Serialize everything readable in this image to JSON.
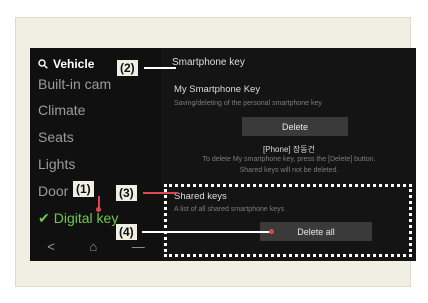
{
  "sidebar": {
    "header": "Vehicle",
    "items": [
      {
        "label": "Built-in cam"
      },
      {
        "label": "Climate"
      },
      {
        "label": "Seats"
      },
      {
        "label": "Lights"
      },
      {
        "label": "Door"
      },
      {
        "label": "Digital key",
        "active": true
      }
    ],
    "nav": [
      "<",
      "⌂",
      "—"
    ]
  },
  "content": {
    "title": "Smartphone key",
    "my_key": {
      "heading": "My Smartphone Key",
      "subtitle": "Saving/deleting of the personal smartphone key",
      "delete_label": "Delete",
      "phone_label": "[Phone] 장동건",
      "note_line1": "To delete My smartphone key, press the [Delete] button.",
      "note_line2": "Shared keys will not be deleted."
    },
    "shared": {
      "heading": "Shared keys",
      "subtitle": "A list of all shared smartphone keys",
      "delete_all_label": "Delete all"
    }
  },
  "callouts": {
    "c1": "(1)",
    "c2": "(2)",
    "c3": "(3)",
    "c4": "(4)"
  },
  "colors": {
    "screen_bg": "#141414",
    "active_green": "#6fc84e",
    "leader_red": "#e0484f",
    "frame_bg": "#f0efe4"
  }
}
